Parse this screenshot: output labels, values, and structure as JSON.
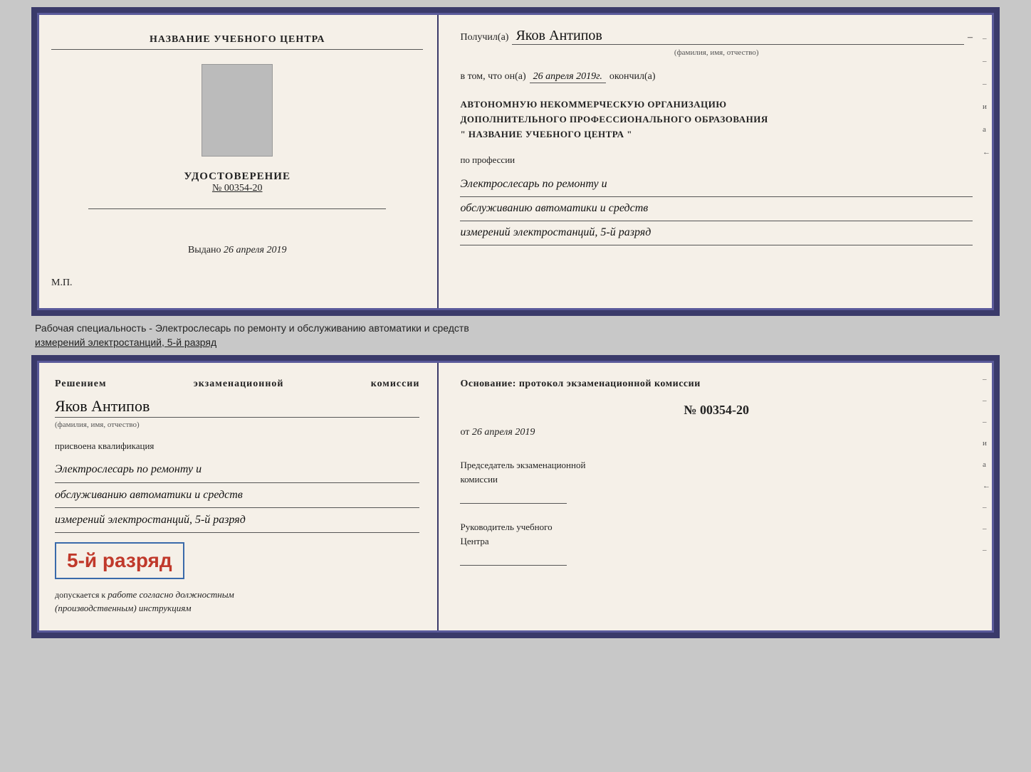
{
  "top_left": {
    "org_name": "НАЗВАНИЕ УЧЕБНОГО ЦЕНТРА",
    "cert_title": "УДОСТОВЕРЕНИЕ",
    "cert_number": "№ 00354-20",
    "issued_label": "Выдано",
    "issued_date": "26 апреля 2019",
    "mp_label": "М.П."
  },
  "top_right": {
    "recipient_prefix": "Получил(а)",
    "recipient_name": "Яков Антипов",
    "name_subtitle": "(фамилия, имя, отчество)",
    "date_prefix": "в том, что он(а)",
    "date_value": "26 апреля 2019г.",
    "date_suffix": "окончил(а)",
    "org_block_line1": "АВТОНОМНУЮ НЕКОММЕРЧЕСКУЮ ОРГАНИЗАЦИЮ",
    "org_block_line2": "ДОПОЛНИТЕЛЬНОГО ПРОФЕССИОНАЛЬНОГО ОБРАЗОВАНИЯ",
    "org_block_line3": "\"   НАЗВАНИЕ УЧЕБНОГО ЦЕНТРА   \"",
    "profession_label": "по профессии",
    "profession_line1": "Электрослесарь по ремонту и",
    "profession_line2": "обслуживанию автоматики и средств",
    "profession_line3": "измерений электростанций, 5-й разряд"
  },
  "middle": {
    "text_line1": "Рабочая специальность - Электрослесарь по ремонту и обслуживанию автоматики и средств",
    "text_line2": "измерений электростанций, 5-й разряд"
  },
  "bottom_left": {
    "commission_title": "Решением экзаменационной комиссии",
    "name": "Яков Антипов",
    "name_subtitle": "(фамилия, имя, отчество)",
    "qualification_label": "присвоена квалификация",
    "qual_line1": "Электрослесарь по ремонту и",
    "qual_line2": "обслуживанию автоматики и средств",
    "qual_line3": "измерений электростанций, 5-й разряд",
    "rank_text": "5-й разряд",
    "admitted_text": "допускается к",
    "admitted_handwritten": "работе согласно должностным",
    "admitted_handwritten2": "(производственным) инструкциям"
  },
  "bottom_right": {
    "basis_label": "Основание: протокол экзаменационной комиссии",
    "protocol_number": "№ 00354-20",
    "protocol_date_prefix": "от",
    "protocol_date": "26 апреля 2019",
    "chairman_title": "Председатель экзаменационной",
    "chairman_title2": "комиссии",
    "head_title": "Руководитель учебного",
    "head_title2": "Центра"
  },
  "edge_marks": {
    "top_right": [
      "–",
      "–",
      "–",
      "и",
      "а",
      "←"
    ],
    "bottom_right": [
      "–",
      "–",
      "–",
      "и",
      "а",
      "←",
      "–",
      "–",
      "–"
    ]
  }
}
